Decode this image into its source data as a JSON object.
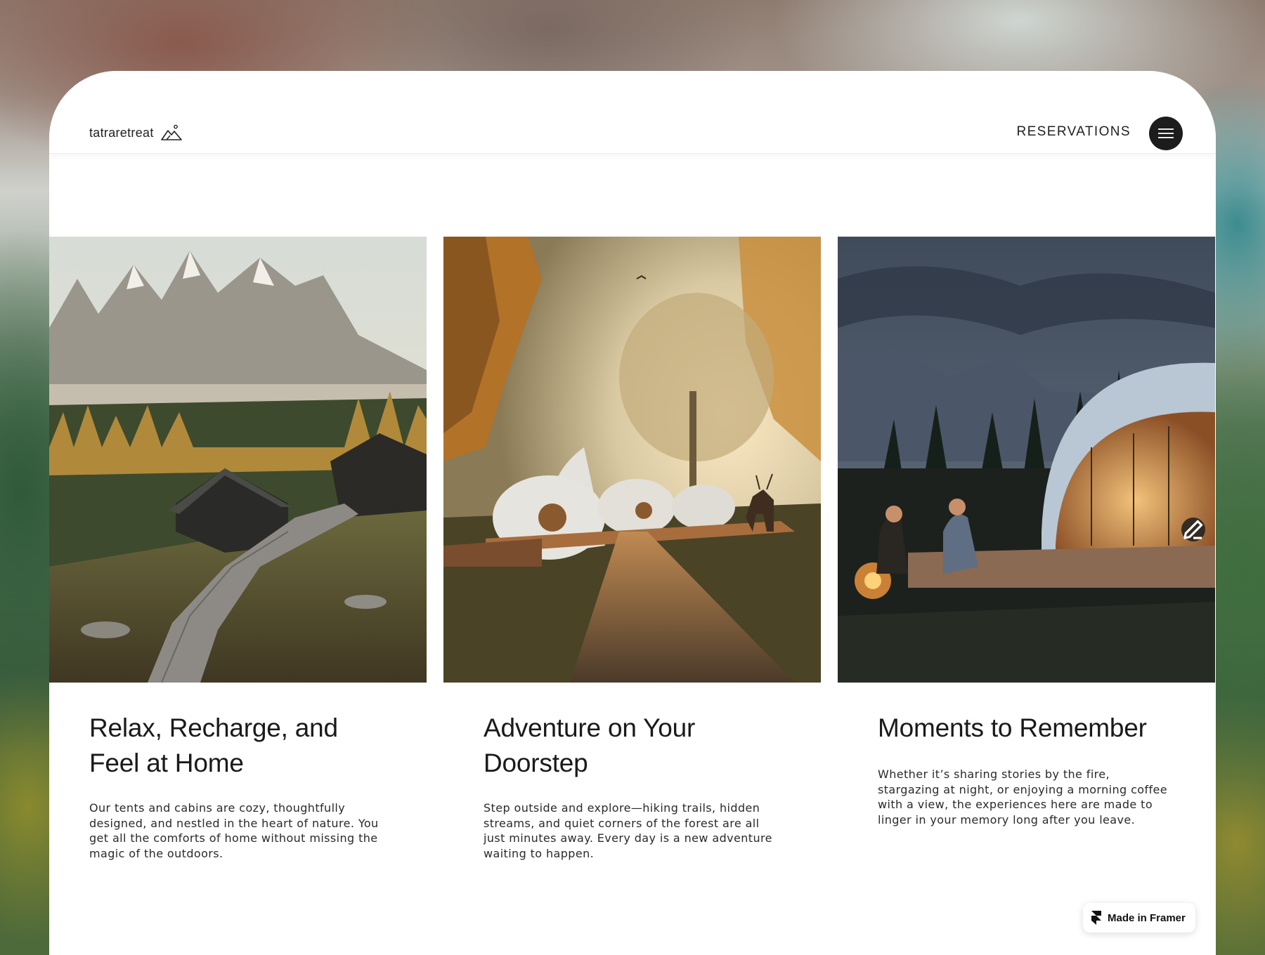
{
  "brand": {
    "name": "tatraretreat",
    "icon": "mountain-icon"
  },
  "nav": {
    "reservations_label": "RESERVATIONS",
    "menu_icon": "hamburger-menu-icon"
  },
  "features": [
    {
      "title": "Relax, Recharge, and Feel at Home",
      "body": "Our tents and cabins are cozy, thoughtfully designed, and nestled in the heart of nature. You get all the comforts of home without missing the magic of the outdoors.",
      "image": "mountain-cabins-boardwalk-photo"
    },
    {
      "title": "Adventure on Your Doorstep",
      "body": "Step outside and explore—hiking trails, hidden streams, and quiet corners of the forest are all just minutes away. Every day is a new adventure waiting to happen.",
      "image": "forest-domes-deer-photo"
    },
    {
      "title": "Moments to Remember",
      "body": "Whether it’s sharing stories by the fire, stargazing at night, or enjoying a morning coffee with a view, the experiences here are made to linger in your memory long after you leave.",
      "image": "evening-dome-campfire-photo"
    }
  ],
  "badge": {
    "label": "Made in Framer",
    "icon": "framer-logo-icon"
  },
  "colors": {
    "card_bg": "#ffffff",
    "menu_button_bg": "#1c1c1c",
    "text": "#1a1a1a"
  }
}
